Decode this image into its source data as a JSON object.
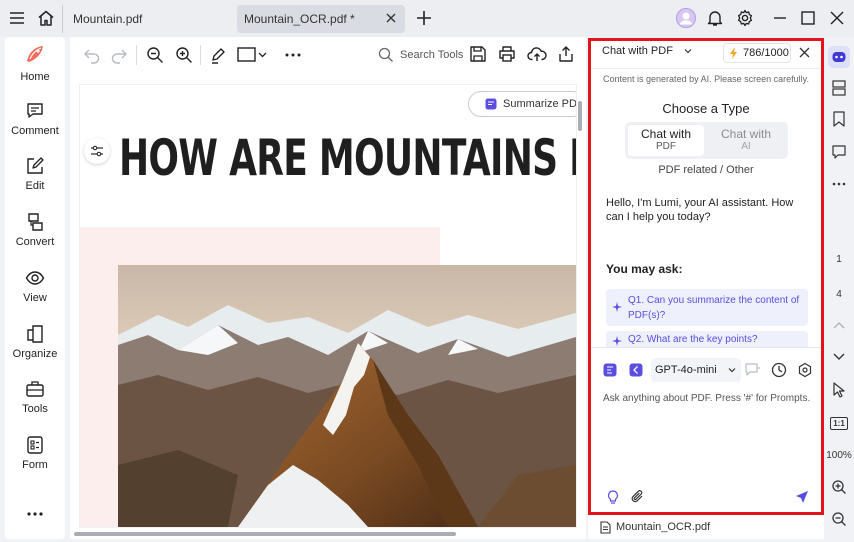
{
  "tabs": [
    {
      "label": "Mountain.pdf"
    },
    {
      "label": "Mountain_OCR.pdf *"
    }
  ],
  "nav": [
    {
      "label": "Home"
    },
    {
      "label": "Comment"
    },
    {
      "label": "Edit"
    },
    {
      "label": "Convert"
    },
    {
      "label": "View"
    },
    {
      "label": "Organize"
    },
    {
      "label": "Tools"
    },
    {
      "label": "Form"
    }
  ],
  "toolbar": {
    "search_label": "Search Tools"
  },
  "document": {
    "summarize_label": "Summarize PDF",
    "heading": "HOW ARE MOUNTAINS FOR"
  },
  "chat": {
    "mode_label": "Chat with PDF",
    "credits": "786/1000",
    "disclaimer": "Content is generated by AI. Please screen carefully.",
    "choose_type": "Choose a Type",
    "option_pdf_title": "Chat with",
    "option_pdf_sub": "PDF",
    "option_ai_title": "Chat with",
    "option_ai_sub": "AI",
    "category": "PDF related / Other",
    "greeting": "Hello, I'm Lumi, your AI assistant. How can I help you today?",
    "you_may_ask": "You may ask:",
    "suggestions": [
      {
        "text": "Q1. Can you summarize the content of PDF(s)?"
      },
      {
        "text": "Q2. What are the key points?"
      }
    ],
    "model": "GPT-4o-mini",
    "input_placeholder": "Ask anything about PDF. Press '#' for Prompts.",
    "file_name": "Mountain_OCR.pdf"
  },
  "pager": {
    "current": "1",
    "total": "4",
    "zoom": "100%",
    "fit_label": "1:1"
  },
  "colors": {
    "accent": "#5b4de0",
    "highlight_border": "#e1141d",
    "suggestion_bg": "#eef0fb",
    "suggestion_text": "#5b4de0"
  }
}
